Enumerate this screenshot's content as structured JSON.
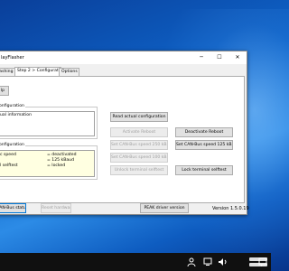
{
  "window": {
    "title": "layFlasher",
    "minimize_glyph": "─",
    "maximize_glyph": "☐",
    "close_glyph": "✕"
  },
  "tabs": [
    {
      "label": "lashing"
    },
    {
      "label": "Step 2 > Configuration"
    },
    {
      "label": "Options"
    }
  ],
  "panel": {
    "top_button_label": "lp",
    "group1_label": "onfiguration",
    "info_text": "ual information",
    "group2_label": "onfiguration",
    "status": [
      {
        "name": "c speed",
        "value": "= deactivated"
      },
      {
        "name": "",
        "value": "= 125 kBaud"
      },
      {
        "name": "l selftest",
        "value": "= locked"
      }
    ],
    "buttons": {
      "read_config": "Read actual configuration",
      "activate_reboot": "Activate Reboot",
      "deactivate_reboot": "Deactivate Reboot",
      "set_250": "Set CAN-Bus speed 250 kBaud",
      "set_125": "Set CAN-Bus speed 125 kBaud",
      "set_100": "Set CAN-Bus speed 100 kBaud",
      "unlock_selftest": "Unlock terminal selftest",
      "lock_selftest": "Lock terminal selftest"
    }
  },
  "footer": {
    "can_status": "CAN-Bus status",
    "reset_hardware": "Reset hardware",
    "peak_driver": "PEAK driver version",
    "version": "Version 1.5.0.19"
  },
  "colors": {
    "desktop": "#0e63c8",
    "status_background": "#ffffe1",
    "focus_border": "#0078d7",
    "disabled_text": "#a0a0a0",
    "taskbar": "#101010"
  },
  "taskbar": {
    "icons": [
      "people-icon",
      "network-icon",
      "volume-icon",
      "notifications-icon"
    ]
  }
}
